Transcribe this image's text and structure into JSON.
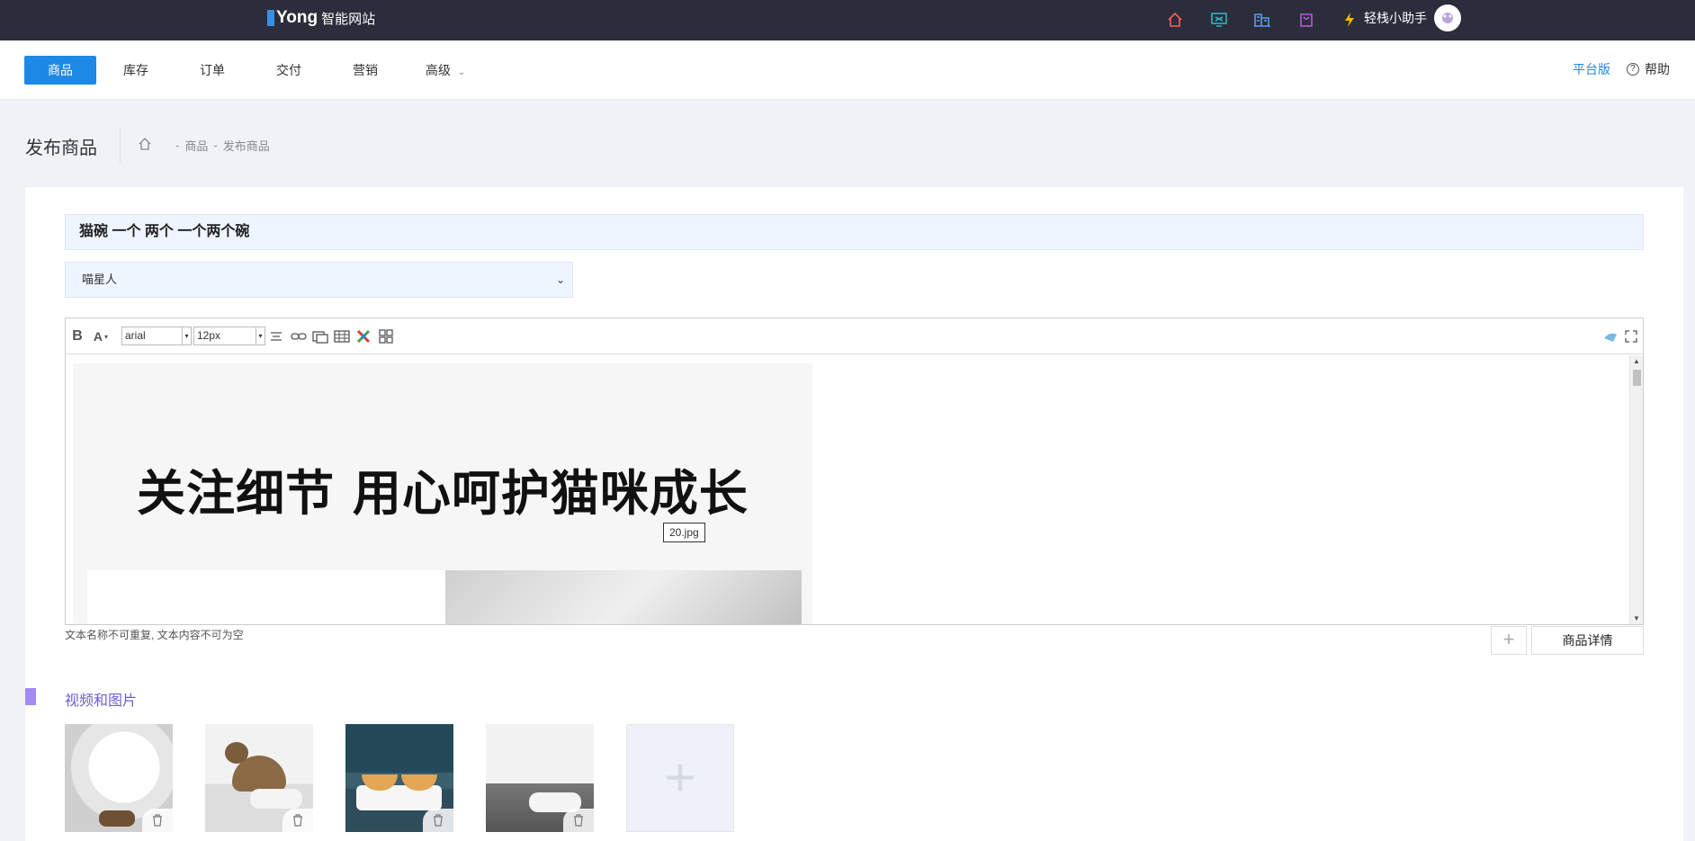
{
  "topbar": {
    "logo_brand": "Yong",
    "logo_sub": "智能网站",
    "icons": [
      {
        "name": "home-icon",
        "color": "#ff5a5a"
      },
      {
        "name": "monitor-icon",
        "color": "#2bb3c0"
      },
      {
        "name": "building-icon",
        "color": "#5a9cf0"
      },
      {
        "name": "bag-icon",
        "color": "#b45ad6"
      },
      {
        "name": "lightning-icon",
        "color": "#ffb400"
      }
    ],
    "user_name": "轻栈小助手"
  },
  "nav": {
    "tabs": [
      "商品",
      "库存",
      "订单",
      "交付",
      "营销",
      "高级"
    ],
    "active_index": 0,
    "platform": "平台版",
    "help": "帮助",
    "accent": "#1e88e5"
  },
  "page": {
    "title": "发布商品",
    "breadcrumb": [
      "商品",
      "发布商品"
    ]
  },
  "form": {
    "product_name": "猫碗 一个 两个 一个两个碗",
    "category": "喵星人",
    "editor": {
      "font": "arial",
      "size": "12px",
      "banner_text": "关注细节  用心呵护猫咪成长",
      "image_label": "20.jpg"
    },
    "hint": "文本名称不可重复, 文本内容不可为空",
    "add_label": "+",
    "detail_button": "商品详情"
  },
  "media": {
    "section_title": "视频和图片",
    "accent": "#a18cf2",
    "items": [
      "video",
      "image",
      "image",
      "image"
    ],
    "add_label": "+"
  }
}
